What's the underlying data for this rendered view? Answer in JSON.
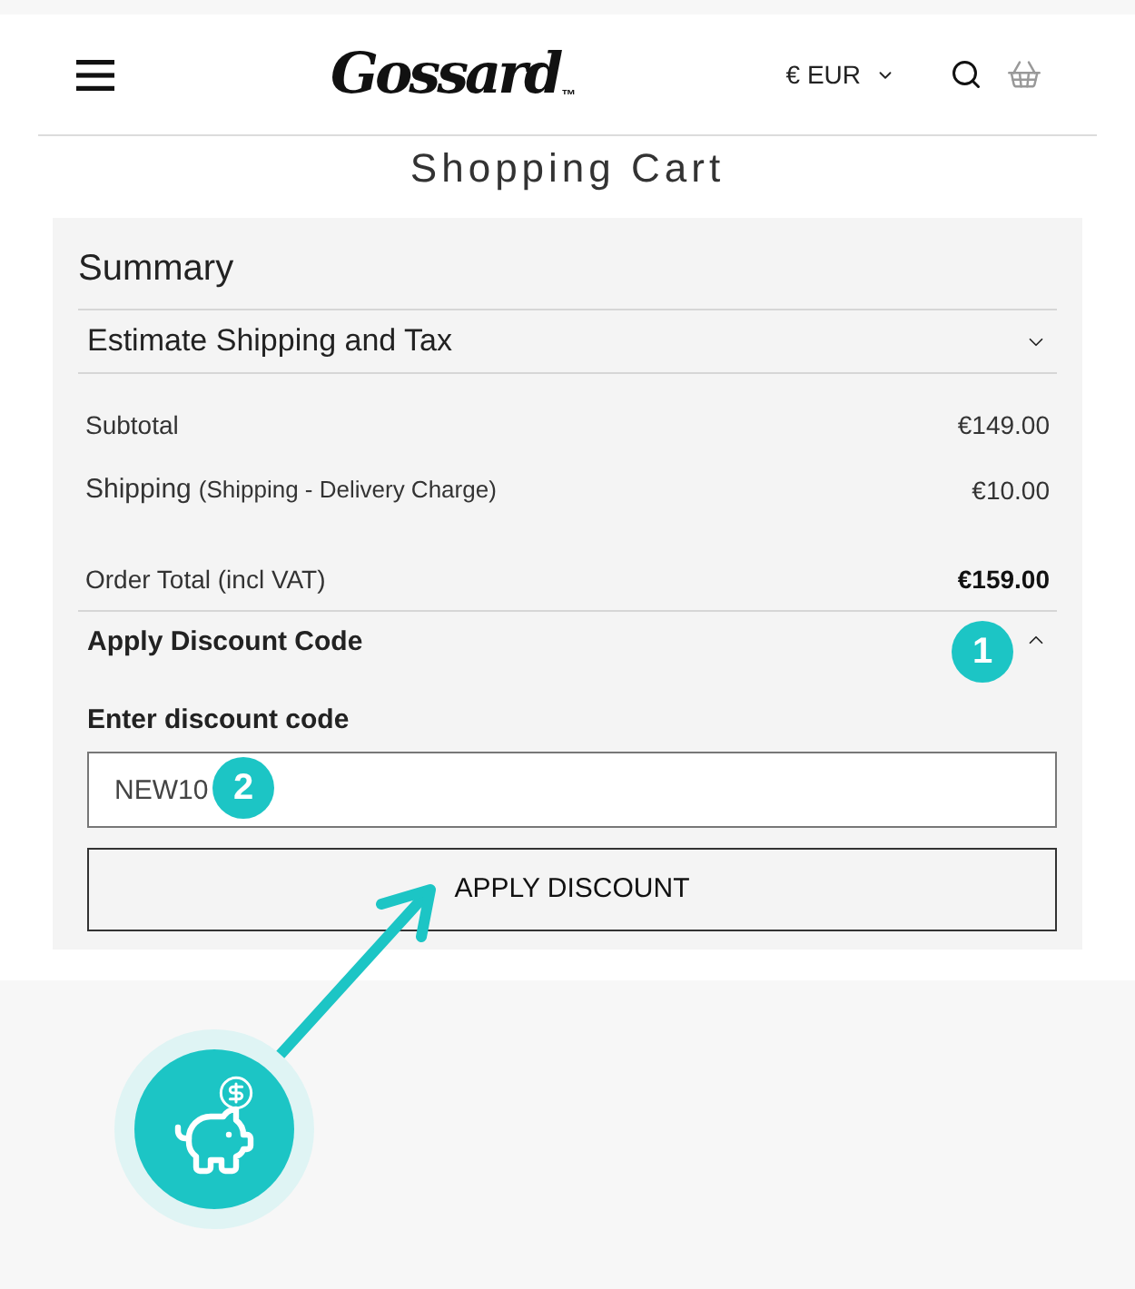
{
  "header": {
    "logo": "Gossard",
    "logo_mark": "™",
    "currency": "€ EUR"
  },
  "page_title": "Shopping Cart",
  "summary": {
    "title": "Summary",
    "estimate": {
      "label": "Estimate Shipping and Tax",
      "expanded": false
    },
    "rows": [
      {
        "kind": "plain",
        "label": "Subtotal",
        "value": "€149.00"
      },
      {
        "kind": "detail",
        "label": "Shipping",
        "note": "(Shipping - Delivery Charge)",
        "value": "€10.00"
      },
      {
        "kind": "total",
        "label": "Order Total (incl VAT)",
        "value": "€159.00"
      }
    ],
    "discount": {
      "label": "Apply Discount Code",
      "expanded": true,
      "field_label": "Enter discount code",
      "value": "NEW10",
      "button": "APPLY DISCOUNT"
    }
  },
  "annotations": {
    "badges": [
      {
        "label": "1"
      },
      {
        "label": "2"
      }
    ]
  }
}
